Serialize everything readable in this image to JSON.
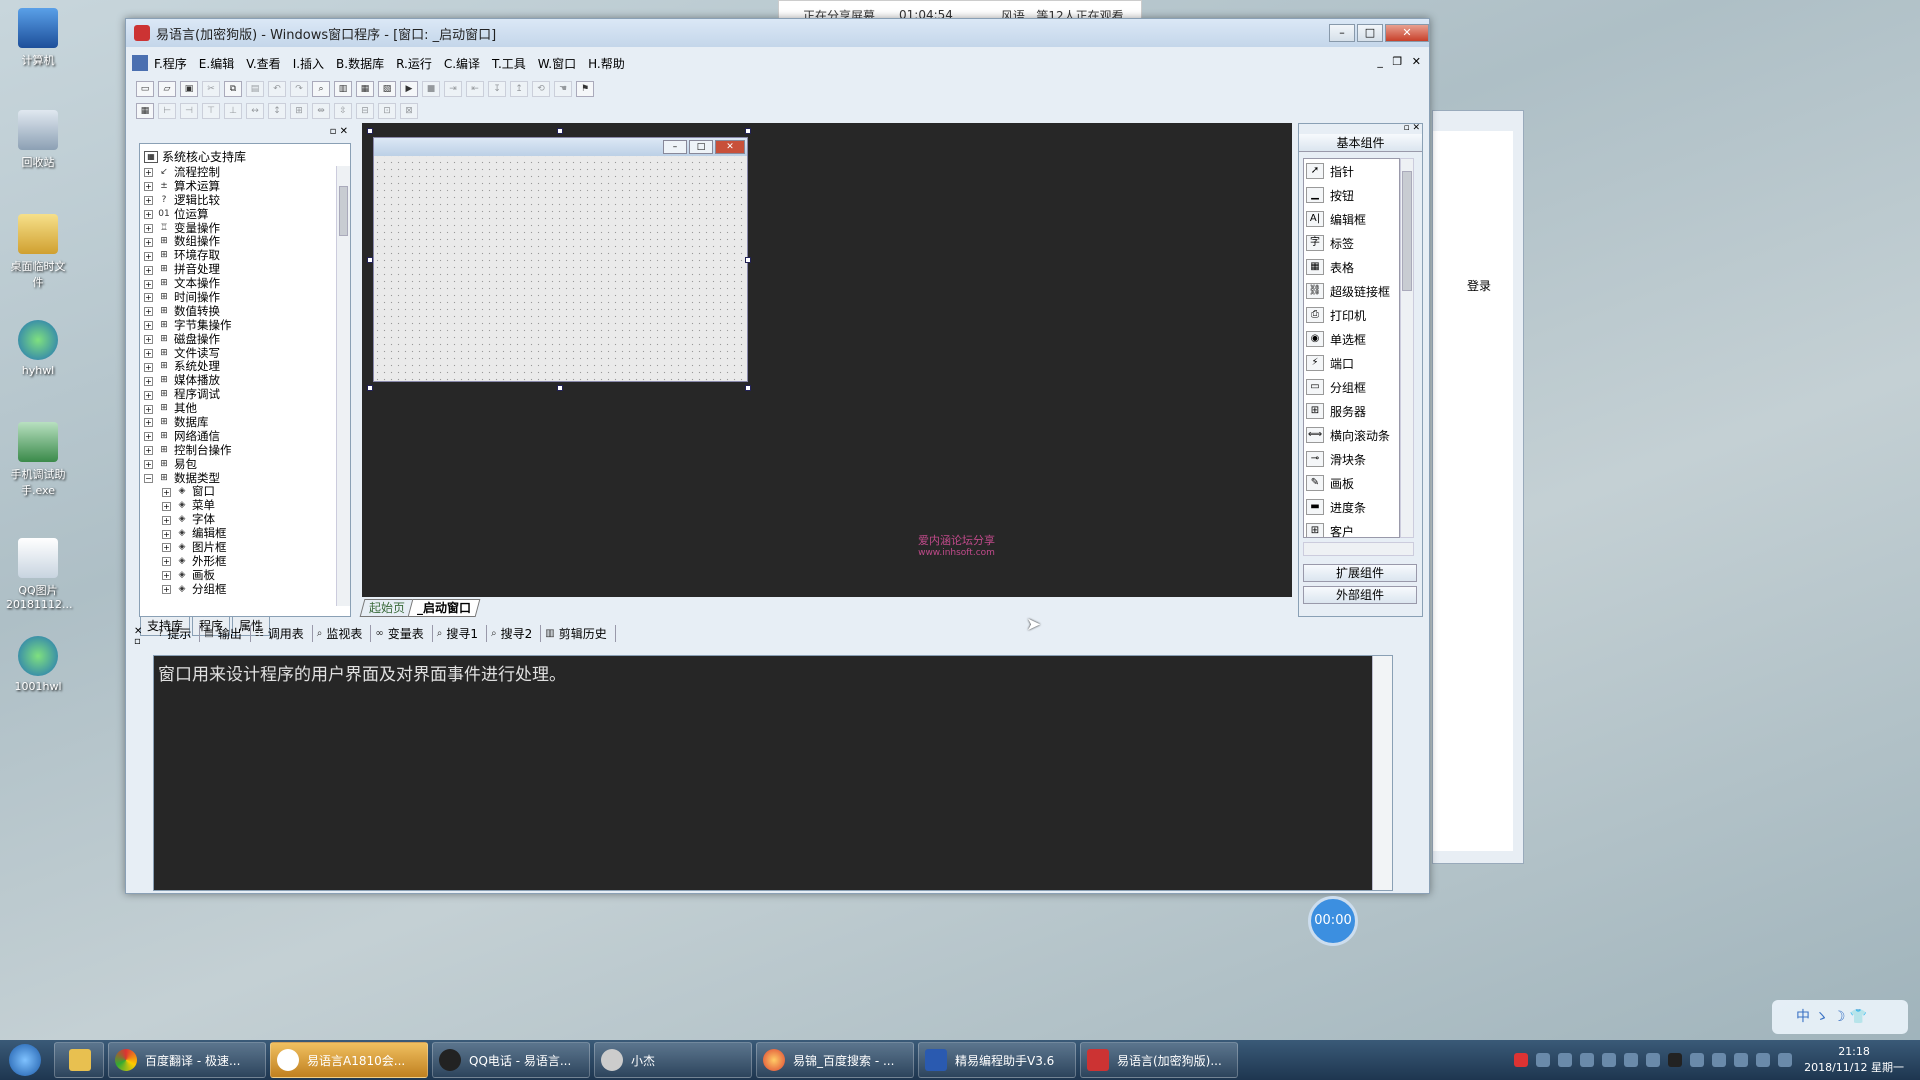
{
  "desktop": {
    "icons": [
      "计算机",
      "回收站",
      "桌面临时文件",
      "hyhwl",
      "手机调试助手.exe",
      "QQ图片20181112...",
      "1001hwl"
    ]
  },
  "share_banner": {
    "status": "正在分享屏幕",
    "time": "01:04:54",
    "viewers": "风语...等12人正在观看"
  },
  "window": {
    "title": "易语言(加密狗版) - Windows窗口程序 - [窗口: _启动窗口]",
    "menu": [
      "F.程序",
      "E.编辑",
      "V.查看",
      "I.插入",
      "B.数据库",
      "R.运行",
      "C.编译",
      "T.工具",
      "W.窗口",
      "H.帮助"
    ],
    "tree": {
      "root": "系统核心支持库",
      "items": [
        "流程控制",
        "算术运算",
        "逻辑比较",
        "位运算",
        "变量操作",
        "数组操作",
        "环境存取",
        "拼音处理",
        "文本操作",
        "时间操作",
        "数值转换",
        "字节集操作",
        "磁盘操作",
        "文件读写",
        "系统处理",
        "媒体播放",
        "程序调试",
        "其他",
        "数据库",
        "网络通信",
        "控制台操作",
        "易包",
        "数据类型"
      ],
      "subitems": [
        "窗口",
        "菜单",
        "字体",
        "编辑框",
        "图片框",
        "外形框",
        "画板",
        "分组框"
      ]
    },
    "left_tabs": [
      "支持库",
      "程序",
      "属性"
    ],
    "doc_tabs": [
      "起始页",
      "_启动窗口"
    ],
    "watermark": {
      "line1": "爱内涵论坛分享",
      "line2": "www.inhsoft.com"
    },
    "components": {
      "header": "基本组件",
      "items": [
        "指针",
        "按钮",
        "编辑框",
        "标签",
        "表格",
        "超级链接框",
        "打印机",
        "单选框",
        "端口",
        "分组框",
        "服务器",
        "横向滚动条",
        "滑块条",
        "画板",
        "进度条",
        "客户"
      ],
      "ext_button": "扩展组件",
      "ext_button2": "外部组件"
    },
    "bottom_tabs": [
      "提示",
      "输出",
      "调用表",
      "监视表",
      "变量表",
      "搜寻1",
      "搜寻2",
      "剪辑历史"
    ],
    "output_text": "窗口用来设计程序的用户界面及对界面事件进行处理。"
  },
  "bg_window": {
    "labels": [
      "登录"
    ]
  },
  "timer": "00:00",
  "ime": "中 ゝ ☽ 👕",
  "taskbar": {
    "tasks": [
      "百度翻译 - 极速...",
      "易语言A1810会...",
      "QQ电话 - 易语言...",
      "小杰",
      "易锦_百度搜索 - ...",
      "精易编程助手V3.6",
      "易语言(加密狗版)..."
    ],
    "clock_time": "21:18",
    "clock_date": "2018/11/12 星期一"
  }
}
